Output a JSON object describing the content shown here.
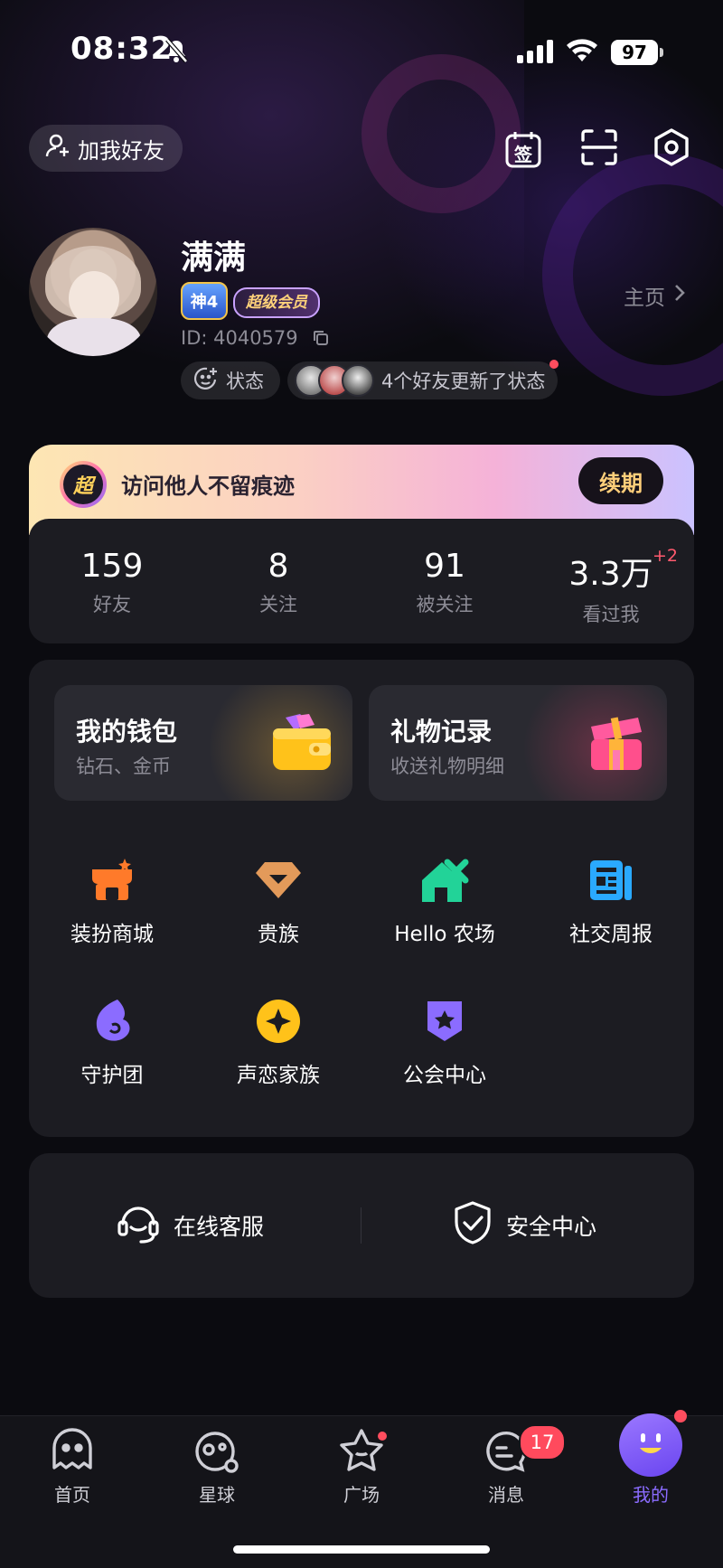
{
  "status_bar": {
    "time": "08:32",
    "battery": "97",
    "icons": [
      "bell-off-icon",
      "signal-icon",
      "wifi-icon",
      "battery-icon"
    ]
  },
  "header": {
    "add_friend_label": "加我好友",
    "checkin_icon_text": "签",
    "icons": [
      "add-user-icon",
      "checkin-icon",
      "scan-icon",
      "settings-icon"
    ]
  },
  "profile": {
    "name": "满满",
    "level_badge": "神4",
    "member_badge": "超级会员",
    "id_label": "ID: 4040579",
    "homepage_label": "主页",
    "status_label": "状态",
    "friends_update": "4个好友更新了状态"
  },
  "vip_banner": {
    "icon_text": "超",
    "text": "访问他人不留痕迹",
    "button": "续期",
    "colors": [
      "#fde6b3",
      "#f5b2d8",
      "#cbc2ff"
    ]
  },
  "stats": [
    {
      "value": "159",
      "label": "好友"
    },
    {
      "value": "8",
      "label": "关注"
    },
    {
      "value": "91",
      "label": "被关注"
    },
    {
      "value": "3.3万",
      "label": "看过我",
      "delta": "+2"
    }
  ],
  "tiles": [
    {
      "title": "我的钱包",
      "subtitle": "钻石、金币",
      "icon": "wallet-icon"
    },
    {
      "title": "礼物记录",
      "subtitle": "收送礼物明细",
      "icon": "gift-box-icon"
    }
  ],
  "grid": [
    {
      "label": "装扮商城",
      "icon": "shop-icon",
      "color": "#ff7a2a"
    },
    {
      "label": "贵族",
      "icon": "diamond-icon",
      "color": "#e39a5a"
    },
    {
      "label": "Hello 农场",
      "icon": "farm-icon",
      "color": "#22d398"
    },
    {
      "label": "社交周报",
      "icon": "report-icon",
      "color": "#2aa9ff"
    },
    {
      "label": "守护团",
      "icon": "guard-icon",
      "color": "#8b6cff"
    },
    {
      "label": "声恋家族",
      "icon": "family-icon",
      "color": "#ffc21a"
    },
    {
      "label": "公会中心",
      "icon": "guild-icon",
      "color": "#8b6cff"
    }
  ],
  "services": [
    {
      "label": "在线客服",
      "icon": "headset-icon"
    },
    {
      "label": "安全中心",
      "icon": "shield-check-icon"
    }
  ],
  "nav": {
    "items": [
      {
        "label": "首页",
        "icon": "home-ghost-icon"
      },
      {
        "label": "星球",
        "icon": "planet-icon"
      },
      {
        "label": "广场",
        "icon": "star-square-icon"
      },
      {
        "label": "消息",
        "icon": "message-icon",
        "badge": "17"
      },
      {
        "label": "我的",
        "icon": "me-icon",
        "active": true
      }
    ],
    "accent": "#8b6cff"
  }
}
